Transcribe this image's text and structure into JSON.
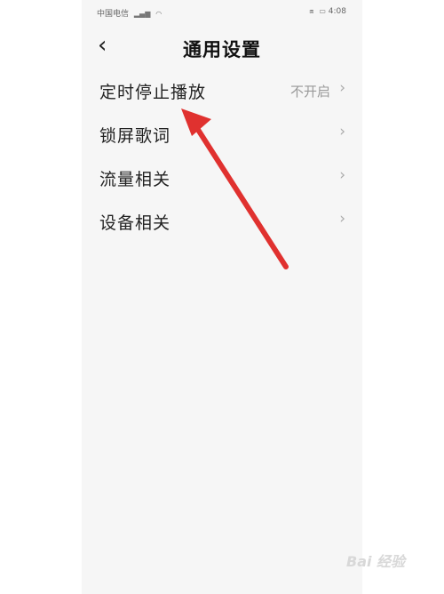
{
  "status_bar": {
    "carrier": "中国电信",
    "time": "4:08"
  },
  "header": {
    "back_icon": "chevron-left-icon",
    "title": "通用设置"
  },
  "settings": [
    {
      "label": "定时停止播放",
      "value": "不开启"
    },
    {
      "label": "锁屏歌词",
      "value": ""
    },
    {
      "label": "流量相关",
      "value": ""
    },
    {
      "label": "设备相关",
      "value": ""
    }
  ],
  "annotation": {
    "color": "#e0312f"
  },
  "watermark": "Bai 经验"
}
